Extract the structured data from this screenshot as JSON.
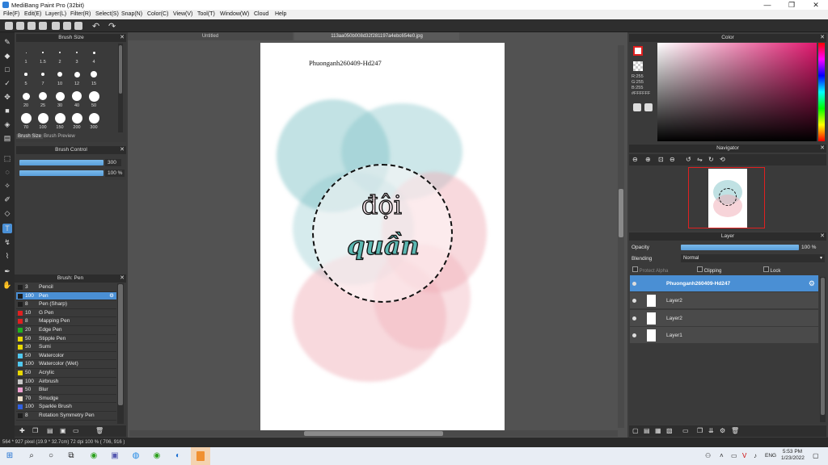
{
  "window": {
    "title": "MediBang Paint Pro (32bit)",
    "minimize": "—",
    "restore": "❐",
    "close": "✕"
  },
  "menu": [
    "File(F)",
    "Edit(E)",
    "Layer(L)",
    "Filter(R)",
    "Select(S)",
    "Snap(N)",
    "Color(C)",
    "View(V)",
    "Tool(T)",
    "Window(W)",
    "Cloud",
    "Help"
  ],
  "tabs": {
    "untitled": "Untitled",
    "active": "113aa050b008d32f281197a4ebc654e0.jpg"
  },
  "brush_size_panel": {
    "title": "Brush Size",
    "sizes": [
      "1",
      "1.5",
      "2",
      "3",
      "4",
      "5",
      "7",
      "10",
      "12",
      "15",
      "20",
      "25",
      "30",
      "40",
      "50",
      "70",
      "100",
      "150",
      "200",
      "300"
    ],
    "tab_size": "Brush Size",
    "tab_preview": "Brush Preview"
  },
  "brush_control": {
    "title": "Brush Control",
    "size_value": "300",
    "opacity_value": "100 %",
    "size_fraction": 1.0,
    "opacity_fraction": 1.0
  },
  "brush_list": {
    "title": "Brush: Pen",
    "items": [
      {
        "size": "3",
        "name": "Pencil",
        "color": "#1e1e1e"
      },
      {
        "size": "100",
        "name": "Pen",
        "color": "#1e1e1e",
        "selected": true
      },
      {
        "size": "8",
        "name": "Pen (Sharp)",
        "color": "#1e1e1e"
      },
      {
        "size": "10",
        "name": "G Pen",
        "color": "#e02020"
      },
      {
        "size": "8",
        "name": "Mapping Pen",
        "color": "#e02020"
      },
      {
        "size": "20",
        "name": "Edge Pen",
        "color": "#20b020"
      },
      {
        "size": "50",
        "name": "Stipple Pen",
        "color": "#e8d800"
      },
      {
        "size": "30",
        "name": "Sumi",
        "color": "#e8d800"
      },
      {
        "size": "50",
        "name": "Watercolor",
        "color": "#50c8f0"
      },
      {
        "size": "100",
        "name": "Watercolor (Wet)",
        "color": "#50c8f0"
      },
      {
        "size": "50",
        "name": "Acrylic",
        "color": "#e8d800"
      },
      {
        "size": "100",
        "name": "Airbrush",
        "color": "#c8c8c8"
      },
      {
        "size": "50",
        "name": "Blur",
        "color": "#f0a0d0"
      },
      {
        "size": "70",
        "name": "Smudge",
        "color": "#f0e0c8"
      },
      {
        "size": "100",
        "name": "Sparkle Brush",
        "color": "#3060e0"
      },
      {
        "size": "8",
        "name": "Rotation Symmetry Pen",
        "color": "#1e1e1e"
      }
    ]
  },
  "canvas": {
    "header_text": "Phuonganh260409-Hd247",
    "line1": "đội",
    "line2": "quần"
  },
  "color_panel": {
    "title": "Color",
    "r": "R:255",
    "g": "G:255",
    "b": "B:255",
    "hex": "#FFFFFF"
  },
  "navigator": {
    "title": "Navigator"
  },
  "layer_panel": {
    "title": "Layer",
    "opacity_label": "Opacity",
    "opacity_value": "100 %",
    "opacity_fraction": 1.0,
    "blending_label": "Blending",
    "blending_value": "Normal",
    "protect_alpha": "Protect Alpha",
    "clipping": "Clipping",
    "lock": "Lock",
    "layers": [
      {
        "name": "Phuonganh260409-Hd247",
        "selected": true
      },
      {
        "name": "Layer2"
      },
      {
        "name": "Layer2"
      },
      {
        "name": "Layer1"
      }
    ]
  },
  "status": "564 * 927 pixel   (19.9 * 32.7cm)   72 dpi   100 %   ( 706, 916 )",
  "taskbar": {
    "lang": "ENG",
    "time": "5:53 PM",
    "date": "1/23/2022"
  }
}
